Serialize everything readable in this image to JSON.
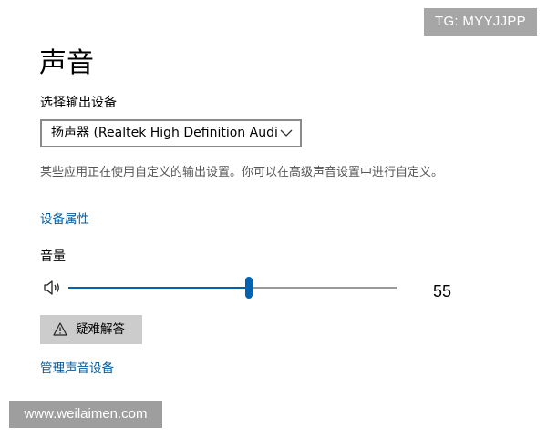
{
  "badge": {
    "text": "TG: MYYJJPP"
  },
  "page": {
    "title": "声音"
  },
  "output": {
    "label": "选择输出设备",
    "selected_device": "扬声器 (Realtek High Definition Audi...",
    "description": "某些应用正在使用自定义的输出设置。你可以在高级声音设置中进行自定义。",
    "device_properties_link": "设备属性"
  },
  "volume": {
    "label": "音量",
    "value": 55,
    "value_text": "55",
    "min": 0,
    "max": 100
  },
  "troubleshoot": {
    "label": "疑难解答"
  },
  "manage_link": {
    "label": "管理声音设备"
  },
  "watermark": {
    "text": "www.weilaimen.com"
  },
  "colors": {
    "accent": "#0063b1",
    "link": "#005a9e",
    "button_bg": "#cccccc",
    "track": "#999999"
  },
  "icons": {
    "speaker": "speaker-icon",
    "chevron": "chevron-down-icon",
    "warning": "warning-icon"
  }
}
